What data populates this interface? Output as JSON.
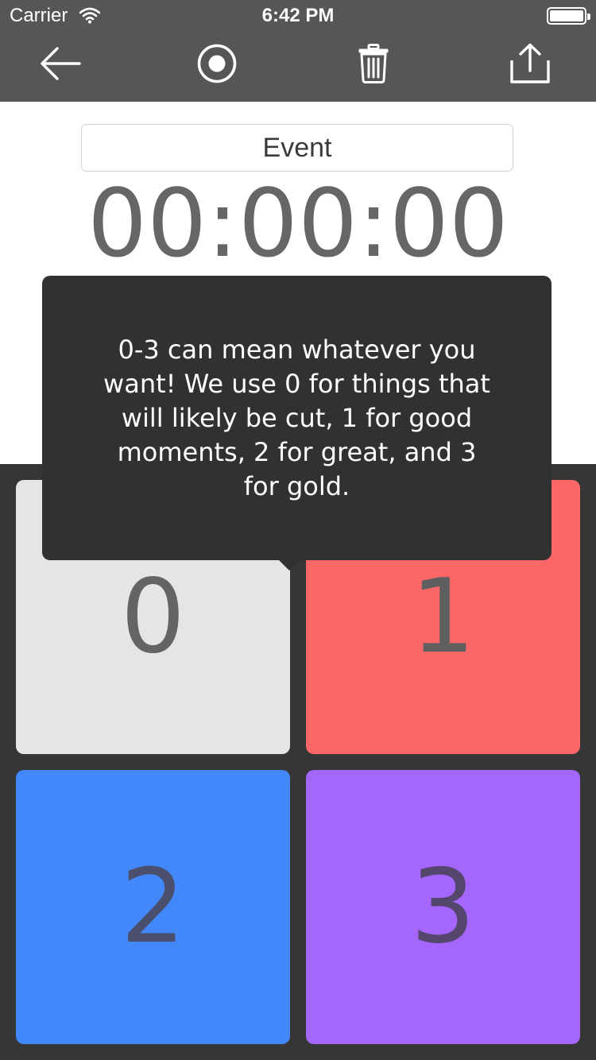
{
  "status_bar": {
    "carrier": "Carrier",
    "time": "6:42 PM",
    "icons": [
      "wifi-icon",
      "battery-icon"
    ]
  },
  "toolbar": {
    "buttons": [
      {
        "icon": "back-arrow-icon"
      },
      {
        "icon": "record-icon"
      },
      {
        "icon": "trash-icon"
      },
      {
        "icon": "share-icon"
      }
    ],
    "color": "#565656"
  },
  "event": {
    "value": "Event"
  },
  "timer": {
    "display": "00:00:00"
  },
  "tooltip": {
    "text": "0-3 can mean whatever you want! We use 0 for things that will likely be cut, 1 for good moments, 2 for great, and 3 for gold."
  },
  "tiles": [
    {
      "label": "0",
      "color": "#e5e5e5",
      "text_color": "#646464"
    },
    {
      "label": "1",
      "color": "#fe6767",
      "text_color": "#5f5f5f"
    },
    {
      "label": "2",
      "color": "#4288fb",
      "text_color": "#4a4f6e"
    },
    {
      "label": "3",
      "color": "#a566fb",
      "text_color": "#55466e"
    }
  ],
  "pad_color": "#363636"
}
